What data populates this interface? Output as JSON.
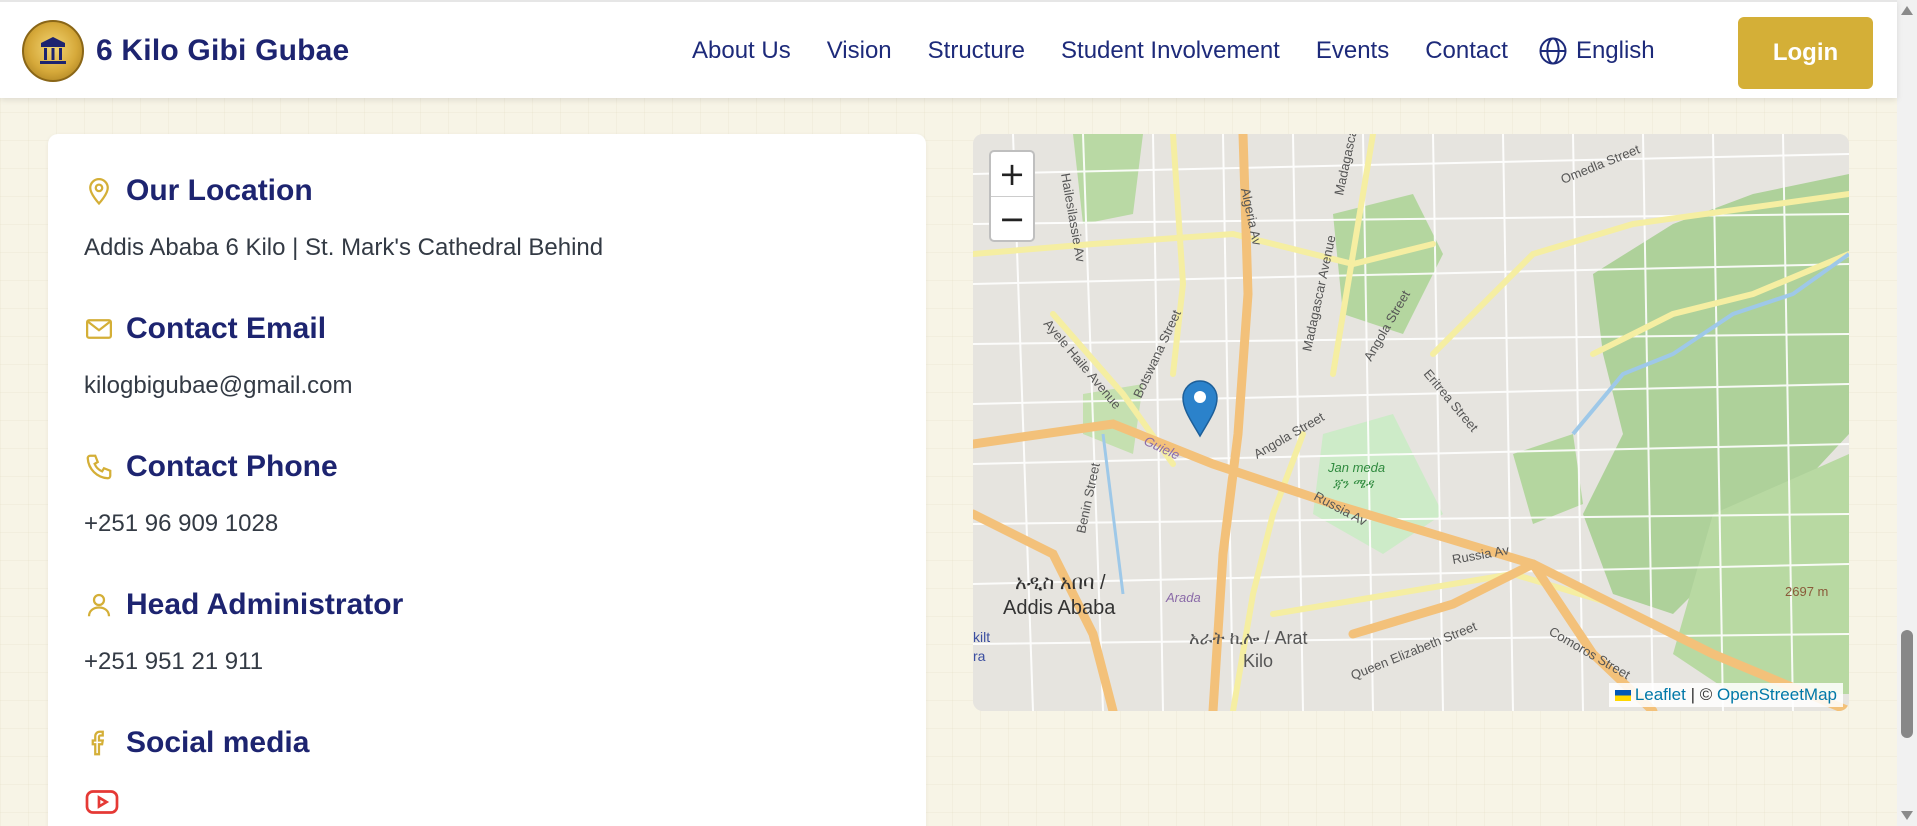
{
  "brand": {
    "name": "6 Kilo Gibi Gubae",
    "logo_icon": "gubae-emblem-icon"
  },
  "nav": {
    "links": [
      "About Us",
      "Vision",
      "Structure",
      "Student Involvement",
      "Events",
      "Contact"
    ],
    "language": "English",
    "login": "Login"
  },
  "colors": {
    "accent": "#d4af37",
    "heading": "#1d2470",
    "youtube": "#e53935"
  },
  "contact": {
    "location": {
      "title": "Our Location",
      "text": "Addis Ababa 6 Kilo | St. Mark's Cathedral Behind",
      "icon": "map-pin-icon"
    },
    "email": {
      "title": "Contact Email",
      "text": "kilogbigubae@gmail.com",
      "icon": "mail-icon"
    },
    "phone": {
      "title": "Contact Phone",
      "text": "+251 96 909 1028",
      "icon": "phone-icon"
    },
    "admin": {
      "title": "Head Administrator",
      "text": "+251 951 21 911",
      "icon": "user-icon"
    },
    "social": {
      "title": "Social media",
      "icon": "facebook-icon",
      "youtube_icon": "youtube-icon"
    }
  },
  "map": {
    "zoom_in": "+",
    "zoom_out": "−",
    "attribution": {
      "leaflet": "Leaflet",
      "separator": " | © ",
      "osm": "OpenStreetMap"
    },
    "labels": {
      "haileselassie": "Hailesilassie Av",
      "algeria": "Algeria Av",
      "madagascar": "Madagascar Avenue",
      "madagasca2": "Madagasca",
      "omedla": "Omedla Street",
      "angola1": "Angola Street",
      "angola2": "Angola Street",
      "ayele": "Ayele Haile Avenue",
      "botswana": "Botswana Street",
      "eritrea": "Eritrea Street",
      "guiele": "Guiele",
      "janmeda": "Jan meda",
      "janmeda_am": "ጃን ሜዳ",
      "russia1": "Russia Av",
      "russia2": "Russia Av",
      "benin": "Benin Street",
      "addis_am": "አዲስ አበባ /",
      "addis_en": "Addis Ababa",
      "arada": "Arada",
      "arat_am": "አራት ኪሎ / Arat",
      "arat_en": "Kilo",
      "queen": "Queen Elizabeth Street",
      "comoros": "Comoros Street",
      "elev": "2697 m",
      "kilt": "kilt",
      "ra": "ra"
    }
  }
}
